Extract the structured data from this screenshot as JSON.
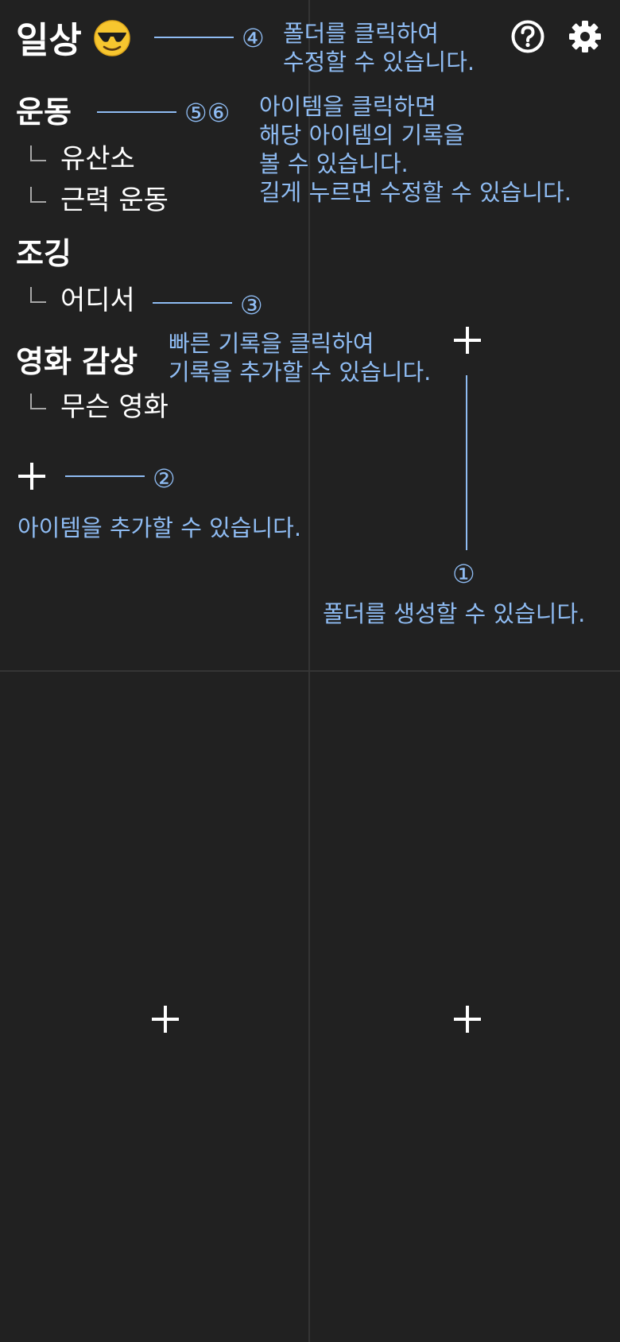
{
  "folders": [
    {
      "title": "일상",
      "emoji_icon": "sunglasses-face-icon",
      "marker": "④",
      "hint_lines": [
        "폴더를 클릭하여",
        "수정할 수 있습니다."
      ]
    }
  ],
  "header_icons": {
    "help": "help-circle-icon",
    "settings": "gear-icon"
  },
  "categories": [
    {
      "name": "운동",
      "marker": "⑤⑥",
      "hint_lines": [
        "아이템을 클릭하면",
        "해당 아이템의 기록을",
        "볼 수 있습니다.",
        "길게 누르면 수정할 수 있습니다."
      ],
      "items": [
        "유산소",
        "근력 운동"
      ]
    },
    {
      "name": "조깅",
      "items": [
        "어디서"
      ],
      "item_marker": "③",
      "item_hint_lines": [
        "빠른 기록을 클릭하여",
        "기록을 추가할 수 있습니다."
      ]
    },
    {
      "name": "영화 감상",
      "items": [
        "무슨 영화"
      ]
    }
  ],
  "add_item": {
    "marker": "②",
    "hint": "아이템을 추가할 수 있습니다."
  },
  "add_folder": {
    "marker": "①",
    "hint": "폴더를 생성할 수 있습니다."
  },
  "colors": {
    "background": "#212121",
    "grid": "#353535",
    "hint": "#8fbcf3",
    "text": "#ffffff",
    "branch": "#a8a8a8"
  }
}
